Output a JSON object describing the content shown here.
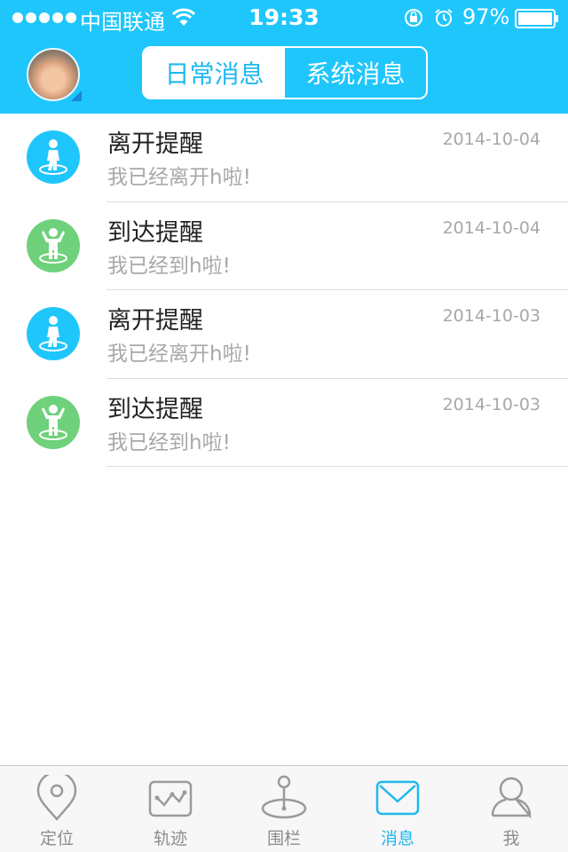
{
  "status_bar": {
    "carrier": "中国联通",
    "time": "19:33",
    "battery": "97%",
    "icons": [
      "signal-dots",
      "wifi-icon",
      "rotation-lock-icon",
      "alarm-icon",
      "battery-icon"
    ]
  },
  "header": {
    "avatar": "avatar",
    "segments": [
      {
        "label": "日常消息",
        "active": true
      },
      {
        "label": "系统消息",
        "active": false
      }
    ]
  },
  "messages": [
    {
      "title": "离开提醒",
      "date": "2014-10-04",
      "text": "我已经离开h啦!",
      "icon": "leave-icon",
      "color": "#1fc6fb"
    },
    {
      "title": "到达提醒",
      "date": "2014-10-04",
      "text": "我已经到h啦!",
      "icon": "arrive-icon",
      "color": "#6fd17b"
    },
    {
      "title": "离开提醒",
      "date": "2014-10-03",
      "text": "我已经离开h啦!",
      "icon": "leave-icon",
      "color": "#1fc6fb"
    },
    {
      "title": "到达提醒",
      "date": "2014-10-03",
      "text": "我已经到h啦!",
      "icon": "arrive-icon",
      "color": "#6fd17b"
    }
  ],
  "tabs": [
    {
      "label": "定位",
      "icon": "location-pin-icon",
      "active": false
    },
    {
      "label": "轨迹",
      "icon": "track-icon",
      "active": false
    },
    {
      "label": "围栏",
      "icon": "fence-icon",
      "active": false
    },
    {
      "label": "消息",
      "icon": "envelope-icon",
      "active": true
    },
    {
      "label": "我",
      "icon": "person-icon",
      "active": false
    }
  ],
  "colors": {
    "accent": "#1fc6fb",
    "green": "#6fd17b",
    "muted": "#a8a8a8"
  }
}
